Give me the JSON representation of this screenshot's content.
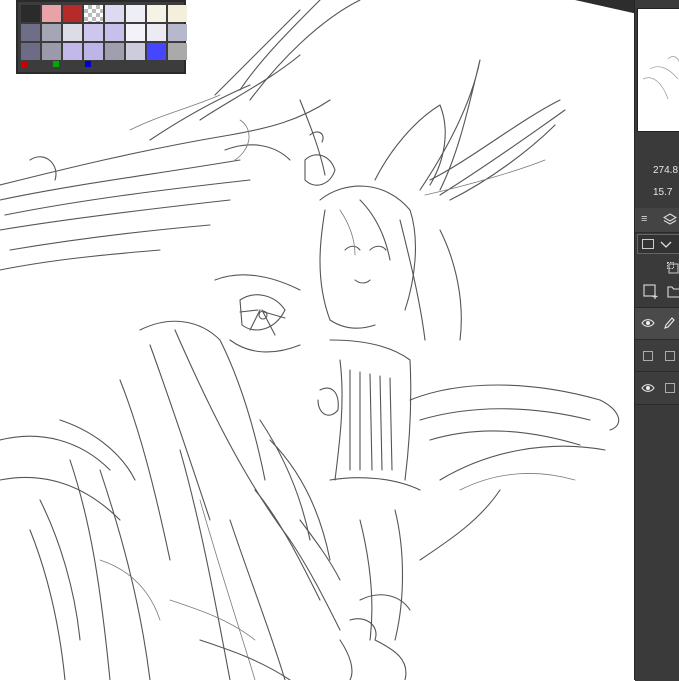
{
  "palette": {
    "swatches": [
      "#2b2b2b",
      "#e9a3a7",
      "#b72a2a",
      "checker",
      "#dcd9f0",
      "#eeeef6",
      "#f5f2e6",
      "#f4efdc",
      "#6e6e88",
      "#a5a5b6",
      "#dcdce6",
      "#cfc6ee",
      "#c6c0ea",
      "#f2f2f8",
      "#ecebf4",
      "#b8b8cc",
      "#6c6c86",
      "#9a9aaa",
      "#c3b8ea",
      "#bdb4e8",
      "#9f9fb0",
      "#ccccdc",
      "#4646ff",
      "#aaaaaa"
    ],
    "mini_colors": [
      "#cc0000",
      "#00aa00",
      "#0000cc"
    ]
  },
  "properties": {
    "value_1": "274.8",
    "value_2": "15.7"
  },
  "icons": {
    "panel_menu": "menu-icon",
    "layer_tab": "layers-icon",
    "blend_dropdown": "chevron-down-icon",
    "new_layer": "new-layer-icon",
    "new_folder": "folder-icon",
    "visibility": "eye-icon",
    "edit": "pencil-icon"
  }
}
